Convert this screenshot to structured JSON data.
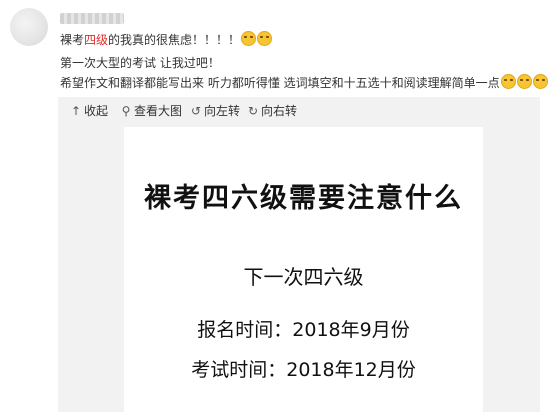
{
  "post": {
    "username": "",
    "line1": "裸考",
    "line1_highlight": "四级",
    "line1_rest": "的我真的很焦虑！！！！",
    "line2": "第一次大型的考试 让我过吧！",
    "line3": "希望作文和翻译都能写出来 听力都听得懂 选词填空和十五选十和阅读理解简单一点",
    "highlight_color": "#e0302b"
  },
  "toolbar": {
    "collapse_label": "收起",
    "view_large_label": "查看大图",
    "rotate_left_label": "向左转",
    "rotate_right_label": "向右转",
    "icons": [
      "up-arrow-icon",
      "search-icon",
      "rotate-left-icon",
      "rotate-right-icon"
    ]
  },
  "image": {
    "title": "裸考四六级需要注意什么",
    "subtitle": "下一次四六级",
    "register_time": "报名时间：2018年9月份",
    "exam_time": "考试时间：2018年12月份"
  }
}
